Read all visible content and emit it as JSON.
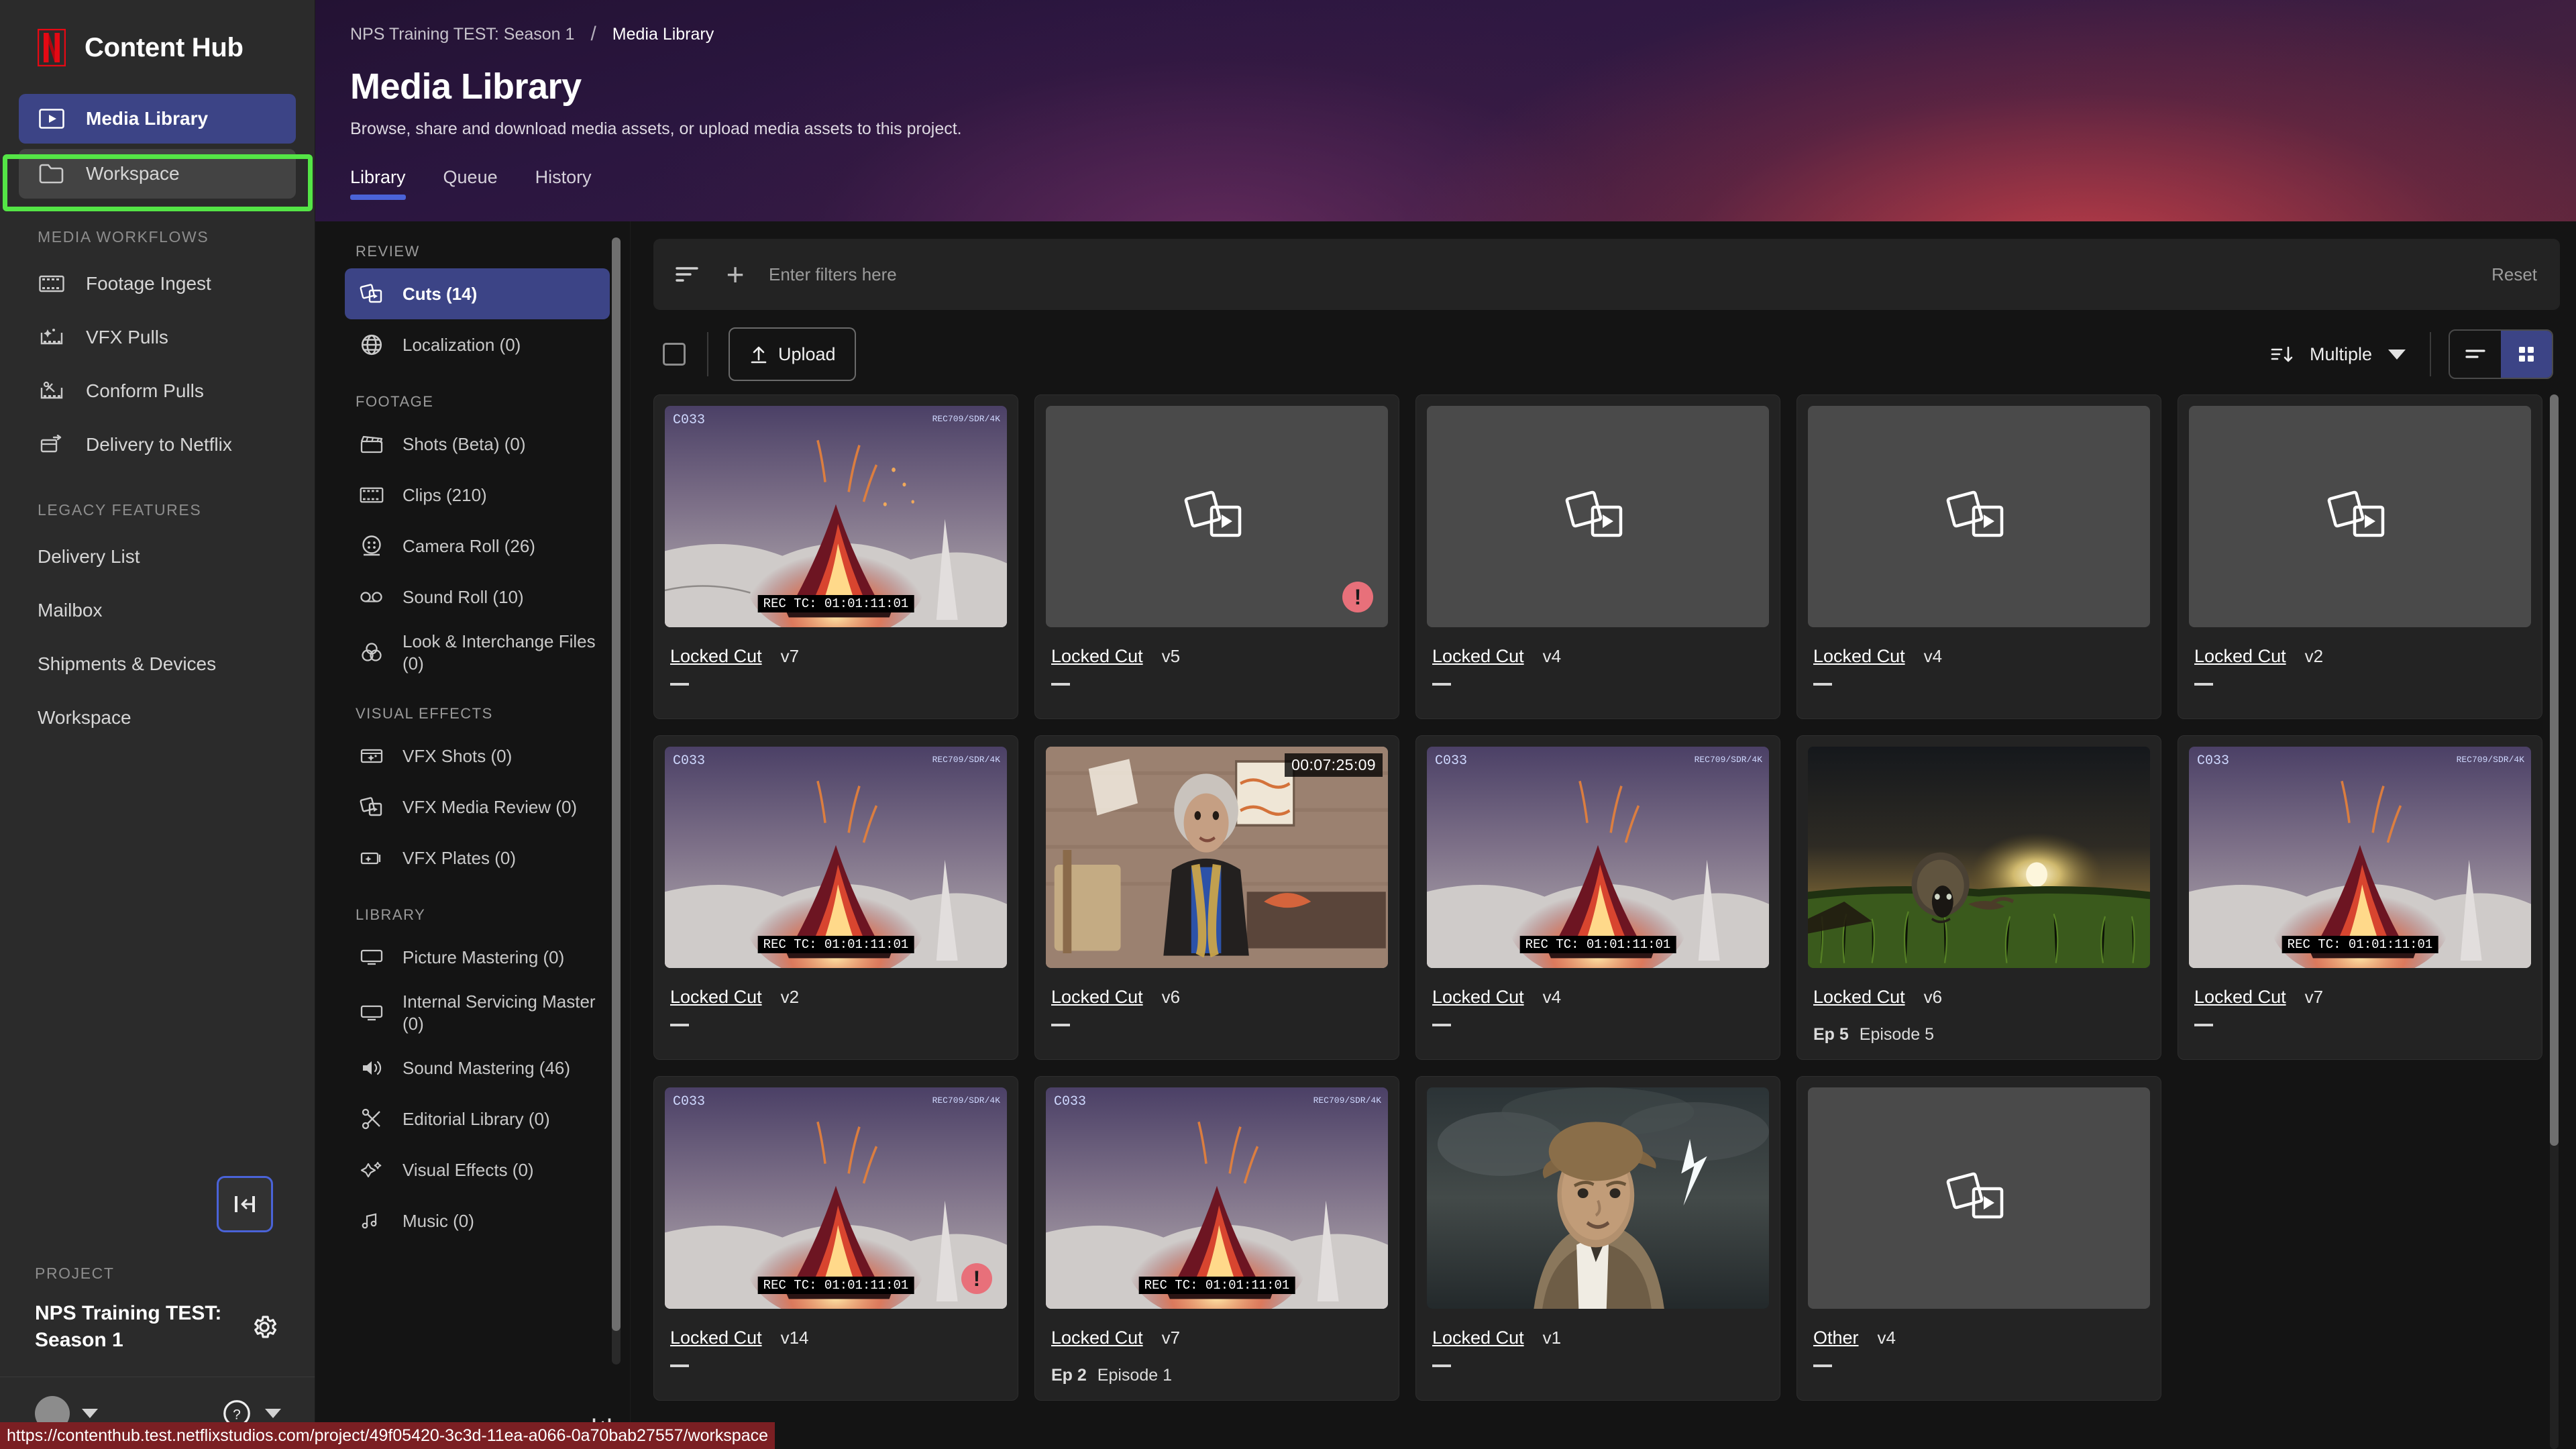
{
  "brand": {
    "title": "Content Hub",
    "logo_icon": "netflix-n-logo"
  },
  "sidebar": {
    "primary": [
      {
        "label": "Media Library",
        "icon": "media-play-icon",
        "state": "active"
      },
      {
        "label": "Workspace",
        "icon": "folder-icon",
        "state": "hovered"
      }
    ],
    "sections": [
      {
        "label": "MEDIA WORKFLOWS",
        "items": [
          {
            "label": "Footage Ingest",
            "icon": "film-strip-icon"
          },
          {
            "label": "VFX Pulls",
            "icon": "film-sparkle-icon"
          },
          {
            "label": "Conform Pulls",
            "icon": "film-scissors-icon"
          },
          {
            "label": "Delivery to Netflix",
            "icon": "delivery-arrow-icon"
          }
        ]
      },
      {
        "label": "LEGACY FEATURES",
        "items": [
          {
            "label": "Delivery List",
            "icon": "none"
          },
          {
            "label": "Mailbox",
            "icon": "none"
          },
          {
            "label": "Shipments & Devices",
            "icon": "none"
          },
          {
            "label": "Workspace",
            "icon": "none"
          }
        ]
      }
    ],
    "collapse_button_icon": "collapse-panel-icon",
    "project": {
      "label": "PROJECT",
      "name": "NPS Training TEST: Season 1",
      "settings_icon": "gear-icon"
    },
    "user": {
      "avatar_icon": "avatar",
      "caret_icon": "chevron-down-icon",
      "help_icon": "help-circle-icon",
      "help_caret_icon": "chevron-down-icon"
    }
  },
  "hero": {
    "breadcrumb": {
      "parent": "NPS Training TEST: Season 1",
      "separator": "/",
      "current": "Media Library"
    },
    "title": "Media Library",
    "subtitle": "Browse, share and download media assets, or upload media assets to this project.",
    "tabs": [
      {
        "label": "Library",
        "active": true
      },
      {
        "label": "Queue",
        "active": false
      },
      {
        "label": "History",
        "active": false
      }
    ]
  },
  "categories": [
    {
      "section": "REVIEW",
      "items": [
        {
          "label": "Cuts (14)",
          "icon": "stacked-media-icon",
          "active": true
        },
        {
          "label": "Localization (0)",
          "icon": "globe-icon",
          "active": false
        }
      ]
    },
    {
      "section": "FOOTAGE",
      "items": [
        {
          "label": "Shots (Beta) (0)",
          "icon": "clapperboard-icon",
          "active": false
        },
        {
          "label": "Clips (210)",
          "icon": "film-strip-icon",
          "active": false
        },
        {
          "label": "Camera Roll (26)",
          "icon": "film-reel-icon",
          "active": false
        },
        {
          "label": "Sound Roll (10)",
          "icon": "audio-reel-icon",
          "active": false
        },
        {
          "label": "Look & Interchange Files (0)",
          "icon": "color-circles-icon",
          "active": false
        }
      ]
    },
    {
      "section": "VISUAL EFFECTS",
      "items": [
        {
          "label": "VFX Shots (0)",
          "icon": "vfx-frame-sparkle-icon",
          "active": false
        },
        {
          "label": "VFX Media Review (0)",
          "icon": "stacked-media-icon",
          "active": false
        },
        {
          "label": "VFX Plates (0)",
          "icon": "vfx-plate-icon",
          "active": false
        }
      ]
    },
    {
      "section": "LIBRARY",
      "items": [
        {
          "label": "Picture Mastering (0)",
          "icon": "monitor-icon",
          "active": false
        },
        {
          "label": "Internal Servicing Master (0)",
          "icon": "monitor-icon",
          "active": false
        },
        {
          "label": "Sound Mastering (46)",
          "icon": "speaker-icon",
          "active": false
        },
        {
          "label": "Editorial Library (0)",
          "icon": "scissors-icon",
          "active": false
        },
        {
          "label": "Visual Effects (0)",
          "icon": "sparkle-icon",
          "active": false
        },
        {
          "label": "Music (0)",
          "icon": "music-note-icon",
          "active": false
        }
      ]
    }
  ],
  "toolbar": {
    "filter_icon": "filter-icon",
    "add_filter_icon": "plus-icon",
    "filter_placeholder": "Enter filters here",
    "filter_value": "",
    "reset_label": "Reset",
    "select_all_checkbox": "unchecked",
    "upload_label": "Upload",
    "upload_icon": "upload-arrow-icon",
    "sort_icon": "sort-descending-icon",
    "sort_label": "Multiple",
    "sort_caret_icon": "chevron-down-icon",
    "view_list_icon": "list-view-icon",
    "view_grid_icon": "grid-view-icon",
    "view_active": "grid"
  },
  "cards": [
    {
      "title": "Locked Cut",
      "version": "v7",
      "sub_dash": "—",
      "thumb": "volcano",
      "slate": "C033",
      "slate_right": "REC709/SDR/4K",
      "rec_tc": "REC TC: 01:01:11:01",
      "error": false
    },
    {
      "title": "Locked Cut",
      "version": "v5",
      "sub_dash": "—",
      "thumb": "placeholder",
      "error": true
    },
    {
      "title": "Locked Cut",
      "version": "v4",
      "sub_dash": "—",
      "thumb": "placeholder",
      "error": false
    },
    {
      "title": "Locked Cut",
      "version": "v4",
      "sub_dash": "—",
      "thumb": "placeholder",
      "error": false
    },
    {
      "title": "Locked Cut",
      "version": "v2",
      "sub_dash": "—",
      "thumb": "placeholder",
      "error": false
    },
    {
      "title": "Locked Cut",
      "version": "v2",
      "sub_dash": "—",
      "thumb": "volcano",
      "slate": "C033",
      "slate_right": "REC709/SDR/4K",
      "rec_tc": "REC TC: 01:01:11:01",
      "error": false
    },
    {
      "title": "Locked Cut",
      "version": "v6",
      "sub_dash": "—",
      "thumb": "interview",
      "timecode": "00:07:25:09",
      "error": false
    },
    {
      "title": "Locked Cut",
      "version": "v4",
      "sub_dash": "—",
      "thumb": "volcano",
      "slate": "C033",
      "slate_right": "REC709/SDR/4K",
      "rec_tc": "REC TC: 01:01:11:01",
      "error": false
    },
    {
      "title": "Locked Cut",
      "version": "v6",
      "ep_number": "Ep 5",
      "ep_name": "Episode 5",
      "thumb": "sheep",
      "error": false
    },
    {
      "title": "Locked Cut",
      "version": "v7",
      "sub_dash": "—",
      "thumb": "volcano",
      "slate": "C033",
      "slate_right": "REC709/SDR/4K",
      "rec_tc": "REC TC: 01:01:11:01",
      "error": false
    },
    {
      "title": "Locked Cut",
      "version": "v14",
      "sub_dash": "—",
      "thumb": "volcano",
      "slate": "C033",
      "slate_right": "REC709/SDR/4K",
      "rec_tc": "REC TC: 01:01:11:01",
      "error": true
    },
    {
      "title": "Locked Cut",
      "version": "v7",
      "ep_number": "Ep 2",
      "ep_name": "Episode 1",
      "thumb": "volcano",
      "slate": "C033",
      "slate_right": "REC709/SDR/4K",
      "rec_tc": "REC TC: 01:01:11:01",
      "error": false
    },
    {
      "title": "Locked Cut",
      "version": "v1",
      "sub_dash": "—",
      "thumb": "portrait",
      "error": false
    },
    {
      "title": "Other",
      "version": "v4",
      "sub_dash": "—",
      "thumb": "placeholder",
      "error": false
    }
  ],
  "status_bar": {
    "url": "https://contenthub.test.netflixstudios.com/project/49f05420-3c3d-11ea-a066-0a70bab27557/workspace"
  },
  "colors": {
    "accent_blue": "#3c4486",
    "highlight_green": "#54e546",
    "error_red": "#e8707a",
    "netflix_red": "#e50914",
    "status_bar_red": "#7b1f23"
  }
}
